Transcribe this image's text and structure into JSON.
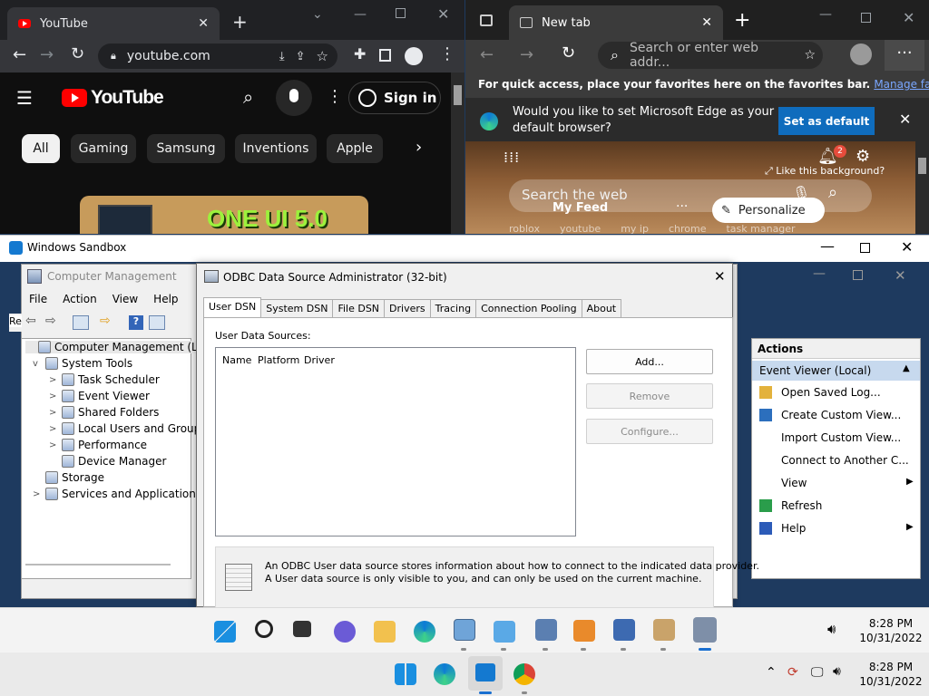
{
  "youtube_window": {
    "tab_title": "YouTube",
    "url": "youtube.com",
    "logo_text": "YouTube",
    "sign_in": "Sign in",
    "chips": [
      "All",
      "Gaming",
      "Samsung",
      "Inventions",
      "Apple"
    ],
    "thumbnail_text": "ONE UI 5.0"
  },
  "edge_window": {
    "tab_title": "New tab",
    "omnibox_placeholder": "Search or enter web addr...",
    "favbar_text": "For quick access, place your favorites here on the favorites bar.",
    "favbar_link": "Manage favorites...",
    "default_prompt_line1": "Would you like to set Microsoft Edge as your",
    "default_prompt_line2": "default browser?",
    "set_default": "Set as default",
    "notification_count": "2",
    "like_bg": "Like this background?",
    "search_web": "Search the web",
    "my_feed": "My Feed",
    "personalize": "Personalize",
    "quick_links": [
      "roblox",
      "youtube",
      "my ip",
      "chrome",
      "task manager"
    ]
  },
  "sandbox": {
    "title": "Windows Sandbox"
  },
  "computer_management": {
    "title": "Computer Management",
    "menu": [
      "File",
      "Action",
      "View",
      "Help"
    ],
    "left_cutoff": "Re",
    "tree": [
      {
        "label": "Computer Management (Local",
        "level": 0,
        "expander": ""
      },
      {
        "label": "System Tools",
        "level": 1,
        "expander": "v"
      },
      {
        "label": "Task Scheduler",
        "level": 2,
        "expander": ">"
      },
      {
        "label": "Event Viewer",
        "level": 2,
        "expander": ">"
      },
      {
        "label": "Shared Folders",
        "level": 2,
        "expander": ">"
      },
      {
        "label": "Local Users and Groups",
        "level": 2,
        "expander": ">"
      },
      {
        "label": "Performance",
        "level": 2,
        "expander": ">"
      },
      {
        "label": "Device Manager",
        "level": 2,
        "expander": ""
      },
      {
        "label": "Storage",
        "level": 1,
        "expander": ""
      },
      {
        "label": "Services and Applications",
        "level": 1,
        "expander": ">"
      }
    ],
    "actions_header": "Actions",
    "actions_section": "Event Viewer (Local)",
    "actions": [
      {
        "label": "Open Saved Log...",
        "submenu": false
      },
      {
        "label": "Create Custom View...",
        "submenu": false
      },
      {
        "label": "Import Custom View...",
        "submenu": false
      },
      {
        "label": "Connect to Another C...",
        "submenu": false
      },
      {
        "label": "View",
        "submenu": true
      },
      {
        "label": "Refresh",
        "submenu": false
      },
      {
        "label": "Help",
        "submenu": true
      }
    ]
  },
  "odbc": {
    "title": "ODBC Data Source Administrator (32-bit)",
    "tabs": [
      "User DSN",
      "System DSN",
      "File DSN",
      "Drivers",
      "Tracing",
      "Connection Pooling",
      "About"
    ],
    "selected_tab": "User DSN",
    "list_label": "User Data Sources:",
    "columns": [
      "Name",
      "Platform",
      "Driver"
    ],
    "buttons": {
      "add": "Add...",
      "remove": "Remove",
      "configure": "Configure..."
    },
    "info_line1": "An ODBC User data source stores information about how to connect to the indicated data provider.",
    "info_line2": "A User data source is only visible to you, and can only be used on the current machine."
  },
  "inner_taskbar": {
    "time": "8:28 PM",
    "date": "10/31/2022"
  },
  "host_taskbar": {
    "time": "8:28 PM",
    "date": "10/31/2022"
  }
}
